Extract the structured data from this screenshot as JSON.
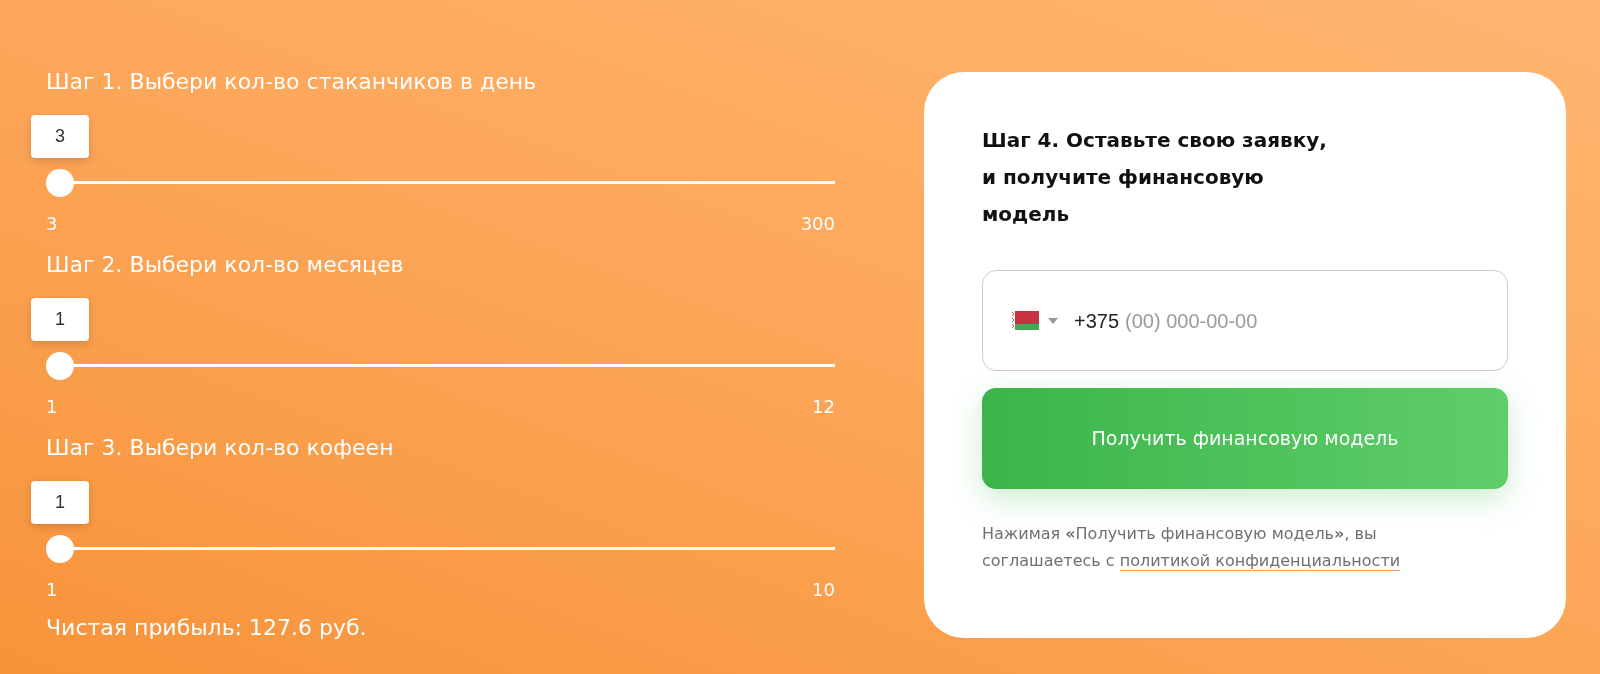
{
  "sliders": [
    {
      "label": "Шаг 1. Выбери кол-во стаканчиков в день",
      "value": "3",
      "level": 0,
      "min": "3",
      "max": "300"
    },
    {
      "label": "Шаг 2. Выбери кол-во месяцев",
      "value": "1",
      "level": 0,
      "min": "1",
      "max": "12"
    },
    {
      "label": "Шаг 3. Выбери кол-во кофеен",
      "value": "1",
      "level": 0,
      "min": "1",
      "max": "10"
    }
  ],
  "profit": "Чистая прибыль: 127.6 руб.",
  "form": {
    "title": "Шаг 4. Оставьте свою заявку,\nи получите финансовую\nмодель",
    "phone": {
      "value": "+375",
      "placeholder": "(00) 000-00-00"
    },
    "submit": "Получить финансовую модель",
    "consent": {
      "text": "Нажимая **«**Получить финансовую модель**»**, вы соглашаетесь с",
      "link": "политикой конфиденциальности"
    }
  }
}
